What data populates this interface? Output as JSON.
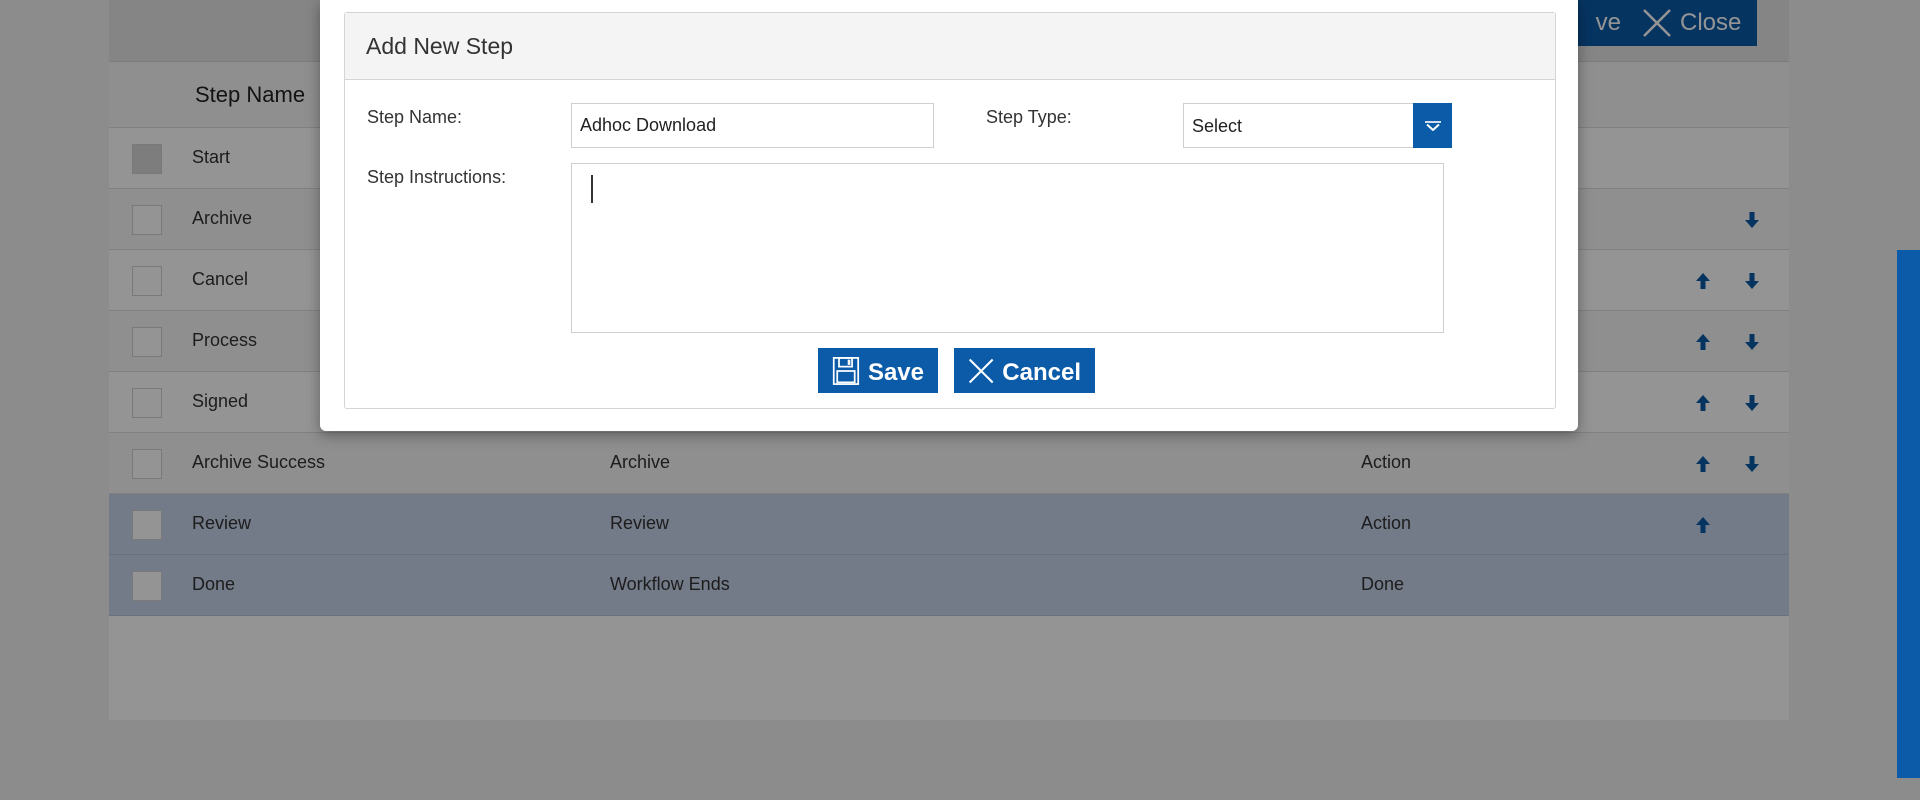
{
  "toolbar": {
    "save_label": "ve",
    "close_label": "Close"
  },
  "table": {
    "header_name": "Step Name",
    "rows": [
      {
        "name": "Start",
        "type": "",
        "kind": "",
        "up": false,
        "down": false,
        "state": "first"
      },
      {
        "name": "Archive",
        "type": "",
        "kind": "",
        "up": false,
        "down": true,
        "state": "alt"
      },
      {
        "name": "Cancel",
        "type": "",
        "kind": "",
        "up": true,
        "down": true,
        "state": ""
      },
      {
        "name": "Process",
        "type": "",
        "kind": "",
        "up": true,
        "down": true,
        "state": "alt"
      },
      {
        "name": "Signed",
        "type": "",
        "kind": "",
        "up": true,
        "down": true,
        "state": ""
      },
      {
        "name": "Archive Success",
        "type": "Archive",
        "kind": "Action",
        "up": true,
        "down": true,
        "state": "alt"
      },
      {
        "name": "Review",
        "type": "Review",
        "kind": "Action",
        "up": true,
        "down": false,
        "state": "sel"
      },
      {
        "name": "Done",
        "type": "Workflow Ends",
        "kind": "Done",
        "up": false,
        "down": false,
        "state": "sel"
      }
    ]
  },
  "modal": {
    "title": "Add New Step",
    "step_name_label": "Step Name:",
    "step_name_value": "Adhoc Download",
    "step_type_label": "Step Type:",
    "step_type_value": "Select",
    "step_instructions_label": "Step Instructions:",
    "step_instructions_value": "",
    "save_label": "Save",
    "cancel_label": "Cancel"
  },
  "colors": {
    "accent": "#0b5ba8",
    "selected_row": "#c6d2ea"
  }
}
